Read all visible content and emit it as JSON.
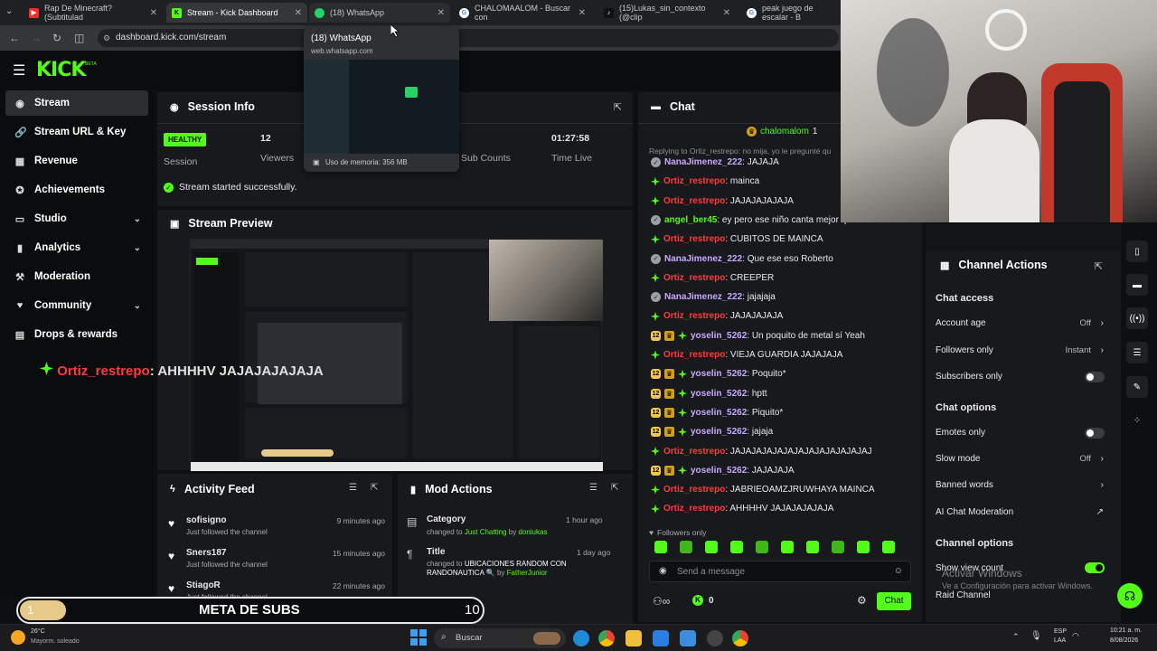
{
  "browser": {
    "tabs": [
      {
        "label": "Rap De Minecraft? (Subtitulad",
        "color": "#ff2b2b",
        "icon": "youtube-icon"
      },
      {
        "label": "Stream - Kick Dashboard",
        "color": "#53fc18",
        "icon": "kick-icon"
      },
      {
        "label": "(18) WhatsApp",
        "color": "#25d366",
        "icon": "whatsapp-icon"
      },
      {
        "label": "CHALOMAALOM - Buscar con",
        "color": "#4285f4",
        "icon": "google-icon"
      },
      {
        "label": "(15)Lukas_sin_contexto (@clip",
        "color": "#111111",
        "icon": "tiktok-icon"
      },
      {
        "label": "peak juego de escalar - B",
        "color": "#4285f4",
        "icon": "google-icon"
      }
    ],
    "url": "dashboard.kick.com/stream",
    "tooltip": {
      "title": "(18) WhatsApp",
      "domain": "web.whatsapp.com",
      "memory": "Uso de memoria: 356 MB"
    }
  },
  "kick": {
    "logo": "KICK",
    "logo_sup": "BETA",
    "sidebar": [
      {
        "label": "Stream",
        "icon": "stream-icon",
        "glyph": "◉",
        "active": true
      },
      {
        "label": "Stream URL & Key",
        "icon": "link-icon",
        "glyph": "🔗"
      },
      {
        "label": "Revenue",
        "icon": "revenue-icon",
        "glyph": "▦"
      },
      {
        "label": "Achievements",
        "icon": "achievements-icon",
        "glyph": "✪"
      },
      {
        "label": "Studio",
        "icon": "studio-icon",
        "glyph": "▭",
        "chevron": true
      },
      {
        "label": "Analytics",
        "icon": "analytics-icon",
        "glyph": "▮",
        "chevron": true
      },
      {
        "label": "Moderation",
        "icon": "moderation-icon",
        "glyph": "⚒"
      },
      {
        "label": "Community",
        "icon": "community-icon",
        "glyph": "♥",
        "chevron": true
      },
      {
        "label": "Drops & rewards",
        "icon": "drops-icon",
        "glyph": "▤"
      }
    ],
    "overlay_chat": {
      "user": "Ortiz_restrepo",
      "text": ": AHHHHV JAJAJAJAJAJA"
    },
    "session": {
      "title": "Session Info",
      "badge": "HEALTHY",
      "session_label": "Session",
      "viewers_value": "12",
      "viewers_label": "Viewers",
      "subcounts_label": "Sub Counts",
      "time_value": "01:27:58",
      "time_label": "Time Live",
      "success": "Stream started successfully."
    },
    "preview": {
      "title": "Stream Preview"
    },
    "activity": {
      "title": "Activity Feed",
      "items": [
        {
          "name": "sofisigno",
          "desc": "Just followed the channel",
          "time": "9 minutes ago"
        },
        {
          "name": "Sners187",
          "desc": "Just followed the channel",
          "time": "15 minutes ago"
        },
        {
          "name": "StiagoR",
          "desc": "Just followed the channel",
          "time": "22 minutes ago"
        }
      ]
    },
    "mod": {
      "title": "Mod Actions",
      "items": [
        {
          "name": "Category",
          "time": "1 hour ago",
          "pre": "changed to ",
          "value": "Just Chatting",
          "by_pre": " by ",
          "by": "doniukas"
        },
        {
          "name": "Title",
          "time": "1 day ago",
          "pre": "changed to ",
          "value": "UBICACIONES RANDOM CON RANDONAUTICA 🔍",
          "by_pre": " by ",
          "by": "FatherJunior"
        }
      ]
    },
    "goal": {
      "current": "1",
      "label": "META DE SUBS",
      "target": "10",
      "progress": 0.1
    },
    "chat": {
      "title": "Chat",
      "pinned_user": "chalomalom",
      "pinned_count": "1",
      "reply": "Replying to Ortiz_restrepo: no mija, yo le pregunté qu",
      "messages": [
        {
          "user": "NanaJimenez_222",
          "text": ": JAJAJA",
          "color": "#c9a8ff",
          "badge": "s"
        },
        {
          "user": "Ortiz_restrepo",
          "text": ": mainca",
          "color": "#ff3b3b",
          "badge": "g"
        },
        {
          "user": "Ortiz_restrepo",
          "text": ": JAJAJAJAJAJA",
          "color": "#ff3b3b",
          "badge": "g"
        },
        {
          "user": "angel_ber45",
          "text": ": ey pero ese niño canta mejor que usted",
          "color": "#53fc18",
          "badge": "s"
        },
        {
          "user": "Ortiz_restrepo",
          "text": ": CUBITOS DE MAINCA",
          "color": "#ff3b3b",
          "badge": "g"
        },
        {
          "user": "NanaJimenez_222",
          "text": ": Que ese eso Roberto",
          "color": "#c9a8ff",
          "badge": "s"
        },
        {
          "user": "Ortiz_restrepo",
          "text": ": CREEPER",
          "color": "#ff3b3b",
          "badge": "g"
        },
        {
          "user": "NanaJimenez_222",
          "text": ": jajajaja",
          "color": "#c9a8ff",
          "badge": "s"
        },
        {
          "user": "Ortiz_restrepo",
          "text": ": JAJAJAJAJA",
          "color": "#ff3b3b",
          "badge": "g"
        },
        {
          "user": "yoselin_5262",
          "text": ": Un poquito de metal sí Yeah",
          "color": "#c9a8ff",
          "badge": "n"
        },
        {
          "user": "Ortiz_restrepo",
          "text": ": VIEJA GUARDIA JAJAJAJA",
          "color": "#ff3b3b",
          "badge": "g"
        },
        {
          "user": "yoselin_5262",
          "text": ": Poquito*",
          "color": "#c9a8ff",
          "badge": "n"
        },
        {
          "user": "yoselin_5262",
          "text": ": hptt",
          "color": "#c9a8ff",
          "badge": "n"
        },
        {
          "user": "yoselin_5262",
          "text": ": Piquito*",
          "color": "#c9a8ff",
          "badge": "n"
        },
        {
          "user": "yoselin_5262",
          "text": ": jajaja",
          "color": "#c9a8ff",
          "badge": "n"
        },
        {
          "user": "Ortiz_restrepo",
          "text": ": JAJAJAJAJAJAJAJAJAJAJAJAJAJ",
          "color": "#ff3b3b",
          "badge": "g"
        },
        {
          "user": "yoselin_5262",
          "text": ": JAJAJAJA",
          "color": "#c9a8ff",
          "badge": "n"
        },
        {
          "user": "Ortiz_restrepo",
          "text": ": JABRIEOAMZJRUWHAYA MAINCA",
          "color": "#ff3b3b",
          "badge": "g"
        },
        {
          "user": "Ortiz_restrepo",
          "text": ": AHHHHV JAJAJAJAJAJA",
          "color": "#ff3b3b",
          "badge": "g"
        }
      ],
      "followers_only": "Followers only",
      "badge_num": "12",
      "input_placeholder": "Send a message",
      "count": "0",
      "send": "Chat"
    },
    "channel_actions": {
      "title": "Channel Actions",
      "chat_access": "Chat access",
      "account_age": "Account age",
      "account_age_val": "Off",
      "followers_only": "Followers only",
      "followers_only_val": "Instant",
      "subscribers_only": "Subscribers only",
      "chat_options": "Chat options",
      "emotes_only": "Emotes only",
      "slow_mode": "Slow mode",
      "slow_mode_val": "Off",
      "banned_words": "Banned words",
      "ai_mod": "AI Chat Moderation",
      "channel_options": "Channel options",
      "show_view_count": "Show view count",
      "raid": "Raid Channel",
      "activate_1": "Activar Windows",
      "activate_2": "Ve a Configuración para activar Windows."
    }
  },
  "taskbar": {
    "weather_temp": "26°C",
    "weather_desc": "Mayorm. soleado",
    "search": "Buscar",
    "lang": "ESP",
    "lang2": "LAA",
    "time": "10:21 a. m.",
    "date": "8/08/2026"
  }
}
